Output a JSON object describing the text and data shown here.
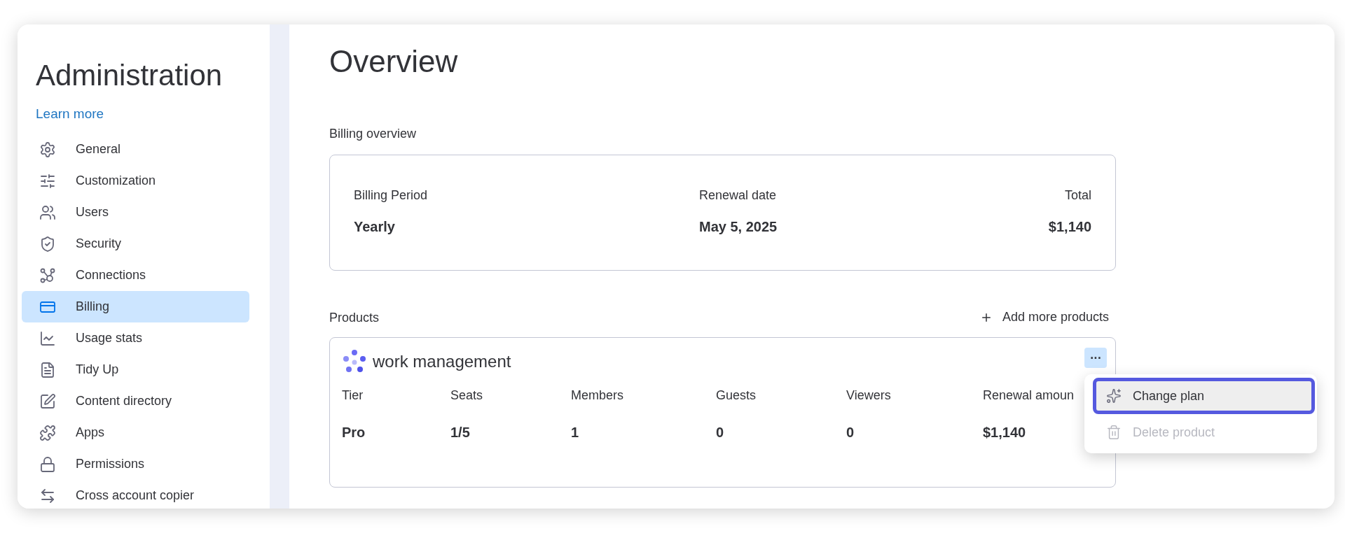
{
  "sidebar": {
    "title": "Administration",
    "link": "Learn more",
    "items": [
      {
        "label": "General",
        "selected": false
      },
      {
        "label": "Customization",
        "selected": false
      },
      {
        "label": "Users",
        "selected": false
      },
      {
        "label": "Security",
        "selected": false
      },
      {
        "label": "Connections",
        "selected": false
      },
      {
        "label": "Billing",
        "selected": true
      },
      {
        "label": "Usage stats",
        "selected": false
      },
      {
        "label": "Tidy Up",
        "selected": false
      },
      {
        "label": "Content directory",
        "selected": false
      },
      {
        "label": "Apps",
        "selected": false
      },
      {
        "label": "Permissions",
        "selected": false
      },
      {
        "label": "Cross account copier",
        "selected": false
      }
    ]
  },
  "main": {
    "title": "Overview",
    "billing": {
      "heading": "Billing overview",
      "fields": [
        {
          "label": "Billing Period",
          "value": "Yearly"
        },
        {
          "label": "Renewal date",
          "value": "May 5, 2025"
        },
        {
          "label": "Total",
          "value": "$1,140"
        }
      ]
    },
    "products": {
      "heading": "Products",
      "add_button": "Add more products",
      "product": {
        "name": "work management",
        "more_button": "···",
        "columns": [
          {
            "label": "Tier",
            "value": "Pro"
          },
          {
            "label": "Seats",
            "value": "1/5"
          },
          {
            "label": "Members",
            "value": "1"
          },
          {
            "label": "Guests",
            "value": "0"
          },
          {
            "label": "Viewers",
            "value": "0"
          },
          {
            "label": "Renewal amoun",
            "value": "$1,140"
          }
        ]
      }
    }
  },
  "menu": {
    "items": [
      {
        "label": "Change plan",
        "highlighted": true,
        "disabled": false
      },
      {
        "label": "Delete product",
        "highlighted": false,
        "disabled": true
      }
    ]
  }
}
